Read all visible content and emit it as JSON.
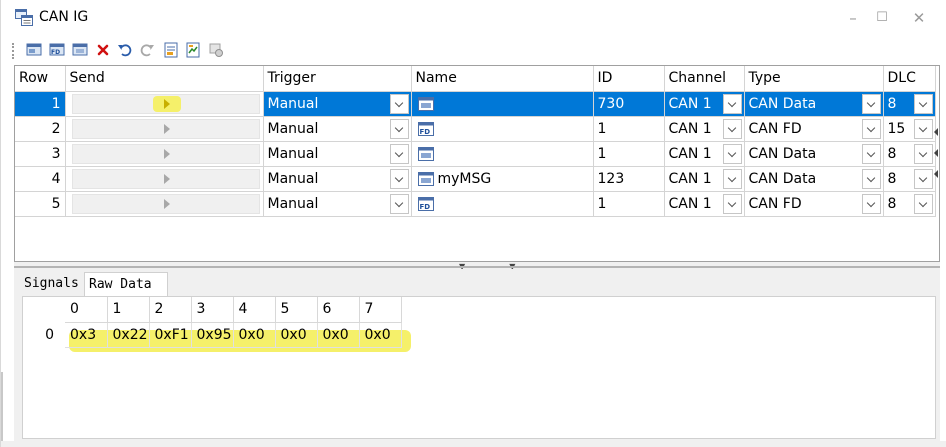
{
  "window": {
    "title": "CAN IG",
    "controls": {
      "minimize": "–",
      "maximize": "☐",
      "close": "✕"
    }
  },
  "toolbar": {
    "buttons": [
      "add-can-message-icon",
      "add-canfd-message-icon",
      "add-message-icon",
      "delete-icon",
      "undo-icon",
      "redo-icon",
      "import-icon",
      "export-icon",
      "settings-icon"
    ]
  },
  "grid": {
    "columns": [
      "Row",
      "Send",
      "Trigger",
      "Name",
      "ID",
      "Channel",
      "Type",
      "DLC"
    ],
    "rows": [
      {
        "row": "1",
        "trigger": "Manual",
        "name": "",
        "name_icon": "can-msg-icon",
        "id": "730",
        "channel": "CAN 1",
        "type": "CAN Data",
        "dlc": "8",
        "selected": true
      },
      {
        "row": "2",
        "trigger": "Manual",
        "name": "",
        "name_icon": "canfd-msg-icon",
        "id": "1",
        "channel": "CAN 1",
        "type": "CAN FD",
        "dlc": "15",
        "selected": false
      },
      {
        "row": "3",
        "trigger": "Manual",
        "name": "",
        "name_icon": "can-msg-icon",
        "id": "1",
        "channel": "CAN 1",
        "type": "CAN Data",
        "dlc": "8",
        "selected": false
      },
      {
        "row": "4",
        "trigger": "Manual",
        "name": "myMSG",
        "name_icon": "can-msg-icon",
        "id": "123",
        "channel": "CAN 1",
        "type": "CAN Data",
        "dlc": "8",
        "selected": false
      },
      {
        "row": "5",
        "trigger": "Manual",
        "name": "",
        "name_icon": "canfd-msg-icon",
        "id": "1",
        "channel": "CAN 1",
        "type": "CAN FD",
        "dlc": "8",
        "selected": false
      }
    ]
  },
  "bottom": {
    "tabs": [
      {
        "label": "Signals",
        "active": false
      },
      {
        "label": "Raw Data",
        "active": true
      }
    ],
    "raw": {
      "columns": [
        "0",
        "1",
        "2",
        "3",
        "4",
        "5",
        "6",
        "7"
      ],
      "rows": [
        {
          "index": "0",
          "bytes": [
            "0x3",
            "0x22",
            "0xF1",
            "0x95",
            "0x0",
            "0x0",
            "0x0",
            "0x0"
          ]
        }
      ]
    }
  },
  "colors": {
    "selection": "#0078d7",
    "highlight": "#f5f06a",
    "grid_line": "#d4d4d4",
    "panel_bg": "#f0f0f0"
  }
}
